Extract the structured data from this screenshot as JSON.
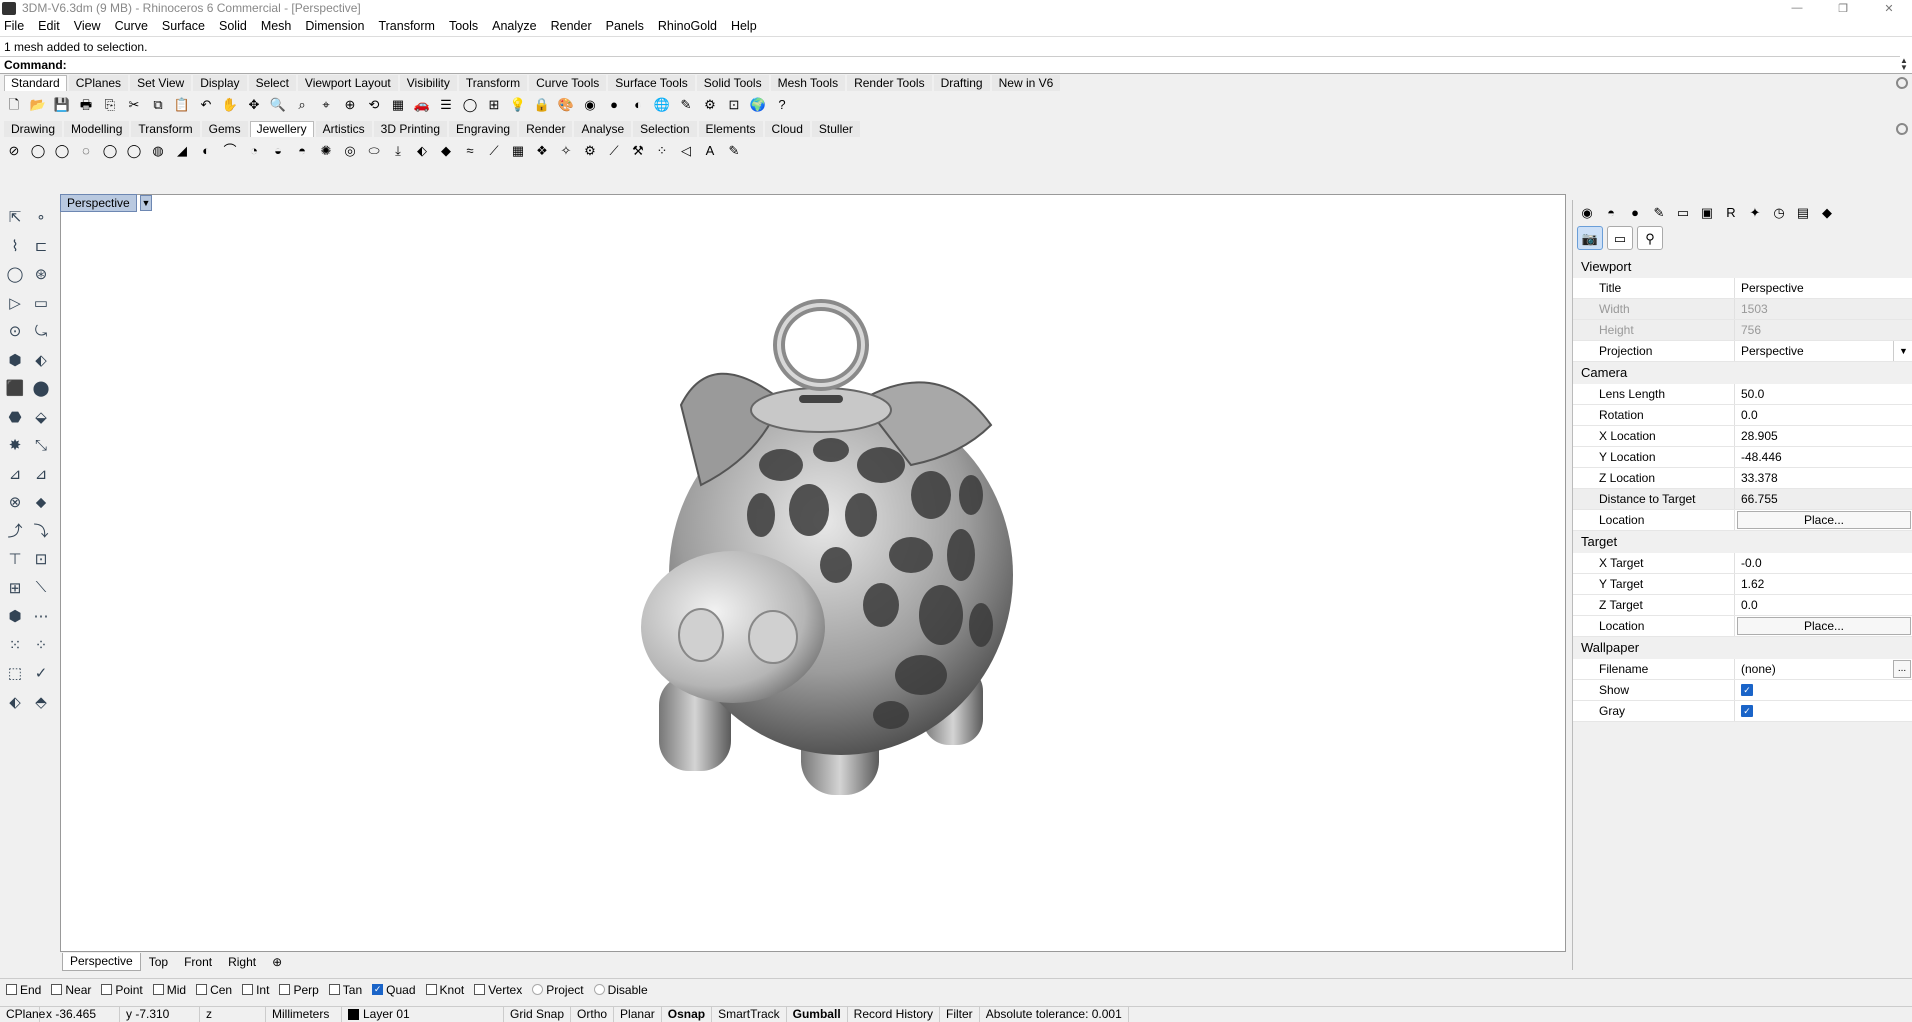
{
  "window": {
    "title": "3DM-V6.3dm (9 MB) - Rhinoceros 6 Commercial - [Perspective]",
    "controls": [
      "—",
      "❐",
      "✕"
    ]
  },
  "menu": [
    "File",
    "Edit",
    "View",
    "Curve",
    "Surface",
    "Solid",
    "Mesh",
    "Dimension",
    "Transform",
    "Tools",
    "Analyze",
    "Render",
    "Panels",
    "RhinoGold",
    "Help"
  ],
  "command": {
    "history": "1 mesh added to selection.",
    "prompt_label": "Command:",
    "value": ""
  },
  "toolbar_tabs": [
    "Standard",
    "CPlanes",
    "Set View",
    "Display",
    "Select",
    "Viewport Layout",
    "Visibility",
    "Transform",
    "Curve Tools",
    "Surface Tools",
    "Solid Tools",
    "Mesh Tools",
    "Render Tools",
    "Drafting",
    "New in V6"
  ],
  "toolbar_tabs_active": 0,
  "standard_icons": [
    "new-icon",
    "open-icon",
    "save-icon",
    "print-icon",
    "import-icon",
    "cut-icon",
    "copy-icon",
    "paste-icon",
    "undo-icon",
    "pan-icon",
    "move-icon",
    "zoom-icon",
    "zoom-window-icon",
    "zoom-extents-icon",
    "zoom-selected-icon",
    "rotate-view-icon",
    "four-viewports-icon",
    "car-icon",
    "cplane-icon",
    "circle-icon",
    "select-icon",
    "light-icon",
    "lock-icon",
    "render-icon",
    "color-wheel-icon",
    "shaded-sphere-icon",
    "render-sphere-icon",
    "blue-sphere-icon",
    "dim-icon",
    "gear-icon",
    "grid-icon",
    "globe-icon",
    "help-icon"
  ],
  "standard_glyphs": [
    "🗋",
    "📂",
    "💾",
    "🖶",
    "⎘",
    "✂",
    "⧉",
    "📋",
    "↶",
    "✋",
    "✥",
    "🔍",
    "⌕",
    "⌖",
    "⊕",
    "⟲",
    "▦",
    "🚗",
    "☰",
    "◯",
    "⊞",
    "💡",
    "🔒",
    "🎨",
    "◉",
    "●",
    "◐",
    "🌐",
    "✎",
    "⚙",
    "⊡",
    "🌍",
    "?"
  ],
  "jewellery_tabs": [
    "Drawing",
    "Modelling",
    "Transform",
    "Gems",
    "Jewellery",
    "Artistics",
    "3D Printing",
    "Engraving",
    "Render",
    "Analyse",
    "Selection",
    "Elements",
    "Cloud",
    "Stuller"
  ],
  "jewellery_tabs_active": 4,
  "jewellery_glyphs": [
    "⊘",
    "◯",
    "◯",
    "◌",
    "◯",
    "◯",
    "◍",
    "◢",
    "◐",
    "⌒",
    "◔",
    "◒",
    "◓",
    "✺",
    "◎",
    "⬭",
    "⤓",
    "⬖",
    "◆",
    "≈",
    "⟋",
    "▦",
    "❖",
    "✧",
    "⚙",
    "⟋",
    "⚒",
    "⁘",
    "◁",
    "A",
    "✎"
  ],
  "jewellery_icons": [
    "ring-icon",
    "ring-icon-2",
    "ring-icon-3",
    "ring-icon-4",
    "ring-icon-5",
    "ring-icon-6",
    "ring-icon-7",
    "shank-icon",
    "bezel-icon",
    "prong-icon",
    "head-icon",
    "band-icon",
    "signet-icon",
    "pave-icon",
    "halo-icon",
    "bail-icon",
    "pendant-icon",
    "cutter-icon",
    "gem-icon",
    "chain-icon",
    "wire-icon",
    "mesh-icon",
    "cluster-icon",
    "star-icon",
    "gear-icon",
    "tool-icon",
    "hammer-icon",
    "dots-icon",
    "shape-icon",
    "text-icon",
    "pen-icon"
  ],
  "left_tools": [
    "⇱",
    "∘",
    "⌇",
    "⊏",
    "◯",
    "⊛",
    "▷",
    "▭",
    "⊙",
    "⤿",
    "⬢",
    "⬖",
    "⬛",
    "⬤",
    "⬣",
    "⬙",
    "✸",
    "⤡",
    "⊿",
    "⊿",
    "⊗",
    "⬥",
    "⤴",
    "⤵",
    "⊤",
    "⊡",
    "⊞",
    "⟍",
    "⬢",
    "⋯",
    "⁙",
    "⁘",
    "⬚",
    "✓",
    "⬖",
    "⬘"
  ],
  "left_tool_names": [
    "select-arrow-icon",
    "point-icon",
    "polyline-icon",
    "curve-icon",
    "circle-icon",
    "circle-center-icon",
    "arc-icon",
    "rectangle-icon",
    "ellipse-icon",
    "arc-3pt-icon",
    "surface-icon",
    "surface-edge-icon",
    "box-icon",
    "sphere-icon",
    "cylinder-icon",
    "extrude-icon",
    "boolean-icon",
    "fillet-icon",
    "trim-icon",
    "split-icon",
    "join-icon",
    "explode-icon",
    "blend-icon",
    "offset-icon",
    "text-icon",
    "array-icon",
    "group-icon",
    "mirror-icon",
    "solid-icon",
    "dimension-icon",
    "grid-array-icon",
    "point-array-icon",
    "block-icon",
    "check-icon",
    "analyze-icon",
    "paint-icon"
  ],
  "viewport": {
    "label": "Perspective",
    "tabs": [
      "Perspective",
      "Top",
      "Front",
      "Right"
    ],
    "active_tab": 0,
    "add_tab": "⊕"
  },
  "osnaps": [
    {
      "label": "End",
      "on": false
    },
    {
      "label": "Near",
      "on": false
    },
    {
      "label": "Point",
      "on": false
    },
    {
      "label": "Mid",
      "on": false
    },
    {
      "label": "Cen",
      "on": false
    },
    {
      "label": "Int",
      "on": false
    },
    {
      "label": "Perp",
      "on": false
    },
    {
      "label": "Tan",
      "on": false
    },
    {
      "label": "Quad",
      "on": true
    },
    {
      "label": "Knot",
      "on": false
    },
    {
      "label": "Vertex",
      "on": false
    }
  ],
  "osnap_extras": [
    "Project",
    "Disable"
  ],
  "status": {
    "cplane": "CPlane",
    "x": "x -36.465",
    "y": "y -7.310",
    "z": "z",
    "units": "Millimeters",
    "layer": "Layer 01",
    "layer_color": "#000000",
    "toggles": [
      "Grid Snap",
      "Ortho",
      "Planar",
      "Osnap",
      "SmartTrack",
      "Gumball",
      "Record History",
      "Filter"
    ],
    "bold_toggles": [
      "Osnap",
      "Gumball"
    ],
    "tolerance": "Absolute tolerance: 0.001"
  },
  "panel": {
    "top_icons": [
      "color-wheel-icon",
      "material-icon",
      "sphere-icon",
      "paint-icon",
      "folder-icon",
      "display-icon",
      "rg-icon",
      "light-icon",
      "clock-icon",
      "layers-icon",
      "help-icon"
    ],
    "top_glyphs": [
      "◉",
      "◓",
      "●",
      "✎",
      "▭",
      "▣",
      "R",
      "✦",
      "◷",
      "▤",
      "◆"
    ],
    "sub_icons": [
      "camera-icon",
      "viewport-icon",
      "named-view-icon"
    ],
    "sub_glyphs": [
      "📷",
      "▭",
      "⚲"
    ],
    "sections": {
      "viewport": {
        "heading": "Viewport",
        "title_label": "Title",
        "title_value": "Perspective",
        "width_label": "Width",
        "width_value": "1503",
        "height_label": "Height",
        "height_value": "756",
        "projection_label": "Projection",
        "projection_value": "Perspective"
      },
      "camera": {
        "heading": "Camera",
        "lens_label": "Lens Length",
        "lens_value": "50.0",
        "rotation_label": "Rotation",
        "rotation_value": "0.0",
        "xloc_label": "X Location",
        "xloc_value": "28.905",
        "yloc_label": "Y Location",
        "yloc_value": "-48.446",
        "zloc_label": "Z Location",
        "zloc_value": "33.378",
        "dist_label": "Distance to Target",
        "dist_value": "66.755",
        "location_label": "Location",
        "location_button": "Place..."
      },
      "target": {
        "heading": "Target",
        "xt_label": "X Target",
        "xt_value": "-0.0",
        "yt_label": "Y Target",
        "yt_value": "1.62",
        "zt_label": "Z Target",
        "zt_value": "0.0",
        "location_label": "Location",
        "location_button": "Place..."
      },
      "wallpaper": {
        "heading": "Wallpaper",
        "filename_label": "Filename",
        "filename_value": "(none)",
        "browse": "...",
        "show_label": "Show",
        "show_checked": true,
        "gray_label": "Gray",
        "gray_checked": true
      }
    }
  }
}
